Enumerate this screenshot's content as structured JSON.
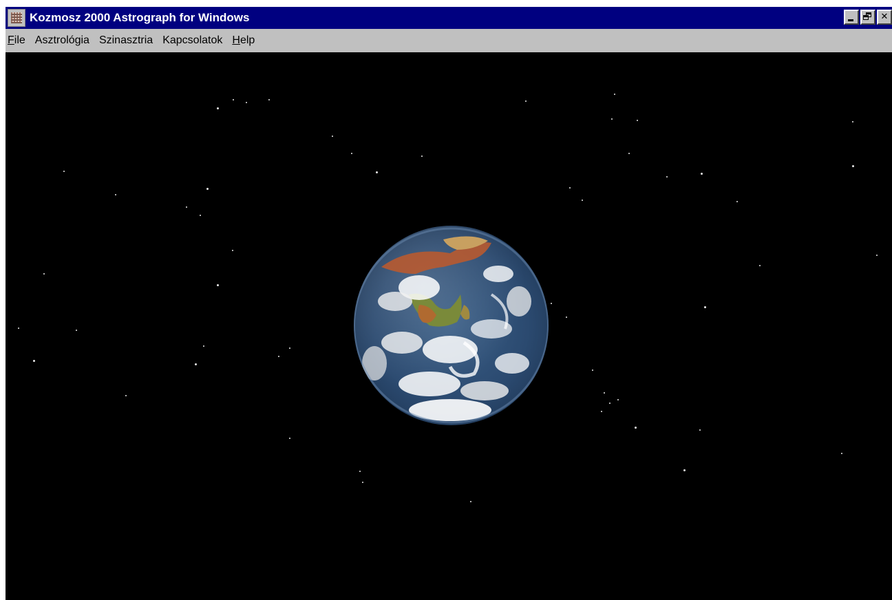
{
  "window": {
    "title": "Kozmosz 2000 Astrograph for Windows",
    "icon": "astrograph-app-icon",
    "controls": [
      "minimize",
      "restore",
      "close"
    ]
  },
  "menu": {
    "items": [
      {
        "label": "File",
        "mnemonic": "F",
        "rest": "ile"
      },
      {
        "label": "Asztrológia"
      },
      {
        "label": "Szinasztria"
      },
      {
        "label": "Kapcsolatok"
      },
      {
        "label": "Help",
        "mnemonic": "H",
        "rest": "elp"
      }
    ]
  },
  "content": {
    "background": "starfield",
    "centerpiece": "earth-globe"
  },
  "colors": {
    "titlebar": "#000080",
    "chrome": "#c0c0c0",
    "space": "#000000"
  }
}
